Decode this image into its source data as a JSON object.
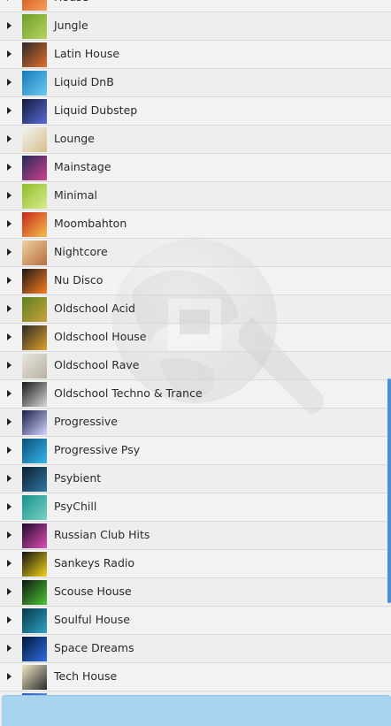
{
  "channels": [
    {
      "label": "House",
      "thumb": [
        "#d54a12",
        "#f2a25b"
      ]
    },
    {
      "label": "Jungle",
      "thumb": [
        "#6d9f2a",
        "#b7d35f"
      ]
    },
    {
      "label": "Latin House",
      "thumb": [
        "#2b2b2b",
        "#e26f2a"
      ]
    },
    {
      "label": "Liquid DnB",
      "thumb": [
        "#157ab8",
        "#6ccbf4"
      ]
    },
    {
      "label": "Liquid Dubstep",
      "thumb": [
        "#121a3a",
        "#5a6bd6"
      ]
    },
    {
      "label": "Lounge",
      "thumb": [
        "#f2f2f2",
        "#d7c08a"
      ]
    },
    {
      "label": "Mainstage",
      "thumb": [
        "#232a5a",
        "#d2408c"
      ]
    },
    {
      "label": "Minimal",
      "thumb": [
        "#8fbc2a",
        "#d9ec8d"
      ]
    },
    {
      "label": "Moombahton",
      "thumb": [
        "#c7251c",
        "#f4c04a"
      ]
    },
    {
      "label": "Nightcore",
      "thumb": [
        "#f0d0a3",
        "#b66e3b"
      ]
    },
    {
      "label": "Nu Disco",
      "thumb": [
        "#1a1a1a",
        "#ff7d1c"
      ]
    },
    {
      "label": "Oldschool Acid",
      "thumb": [
        "#5f7f22",
        "#c8a43a"
      ]
    },
    {
      "label": "Oldschool House",
      "thumb": [
        "#2a2a2a",
        "#e0a12a"
      ]
    },
    {
      "label": "Oldschool Rave",
      "thumb": [
        "#e8e5dd",
        "#b8b1a3"
      ]
    },
    {
      "label": "Oldschool Techno & Trance",
      "thumb": [
        "#1a1a1a",
        "#d8d8d8"
      ]
    },
    {
      "label": "Progressive",
      "thumb": [
        "#1a1d4a",
        "#d5d5ff"
      ]
    },
    {
      "label": "Progressive Psy",
      "thumb": [
        "#0a4f7a",
        "#35b7ec"
      ]
    },
    {
      "label": "Psybient",
      "thumb": [
        "#0d1f2f",
        "#2e78a3"
      ]
    },
    {
      "label": "PsyChill",
      "thumb": [
        "#16918c",
        "#79d2c3"
      ]
    },
    {
      "label": "Russian Club Hits",
      "thumb": [
        "#1d0a2a",
        "#e24eb8"
      ]
    },
    {
      "label": "Sankeys Radio",
      "thumb": [
        "#111111",
        "#f4d41d"
      ]
    },
    {
      "label": "Scouse House",
      "thumb": [
        "#101510",
        "#4ec83a"
      ]
    },
    {
      "label": "Soulful House",
      "thumb": [
        "#063848",
        "#2fa3c6"
      ]
    },
    {
      "label": "Space Dreams",
      "thumb": [
        "#02173a",
        "#2e6fe0"
      ]
    },
    {
      "label": "Tech House",
      "thumb": [
        "#efe6c4",
        "#2b2b2b"
      ]
    },
    {
      "label": "",
      "thumb": [
        "#2a5ab8",
        "#7fb1f0"
      ]
    }
  ],
  "colors": {
    "accent": "#4a90d9",
    "bottom_bar": "#a8d3ef"
  },
  "icons": {
    "expander": "triangle-right-icon",
    "watermark": "globe-magnifier-icon"
  }
}
